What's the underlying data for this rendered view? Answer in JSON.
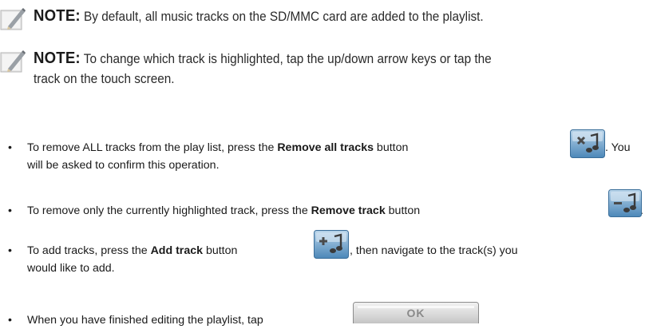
{
  "note1": {
    "label": "NOTE:",
    "text": " By default, all music tracks on the SD/MMC card are added to the playlist."
  },
  "note2": {
    "label": "NOTE:",
    "line1": " To change which track is highlighted, tap the up/down arrow keys or tap the",
    "line2": "track on the touch screen."
  },
  "bullets": {
    "b1": {
      "pre": "To remove ALL tracks from the play list, press the ",
      "bold": "Remove all tracks",
      "post": " button",
      "after": ". You",
      "line2": "will be asked to confirm this operation."
    },
    "b2": {
      "pre": "To remove only the currently highlighted track, press the ",
      "bold": "Remove track",
      "post": " button",
      "after": "."
    },
    "b3": {
      "pre": "To add tracks, press the ",
      "bold": "Add track",
      "post": " button",
      "after": ", then navigate to the track(s) you",
      "line2": "would like to add."
    },
    "b4": {
      "pre": "When you have finished editing the playlist, tap"
    }
  },
  "buttons": {
    "ok_label": "OK",
    "remove_all_icon": "remove-all-tracks-icon",
    "remove_track_icon": "remove-track-icon",
    "add_track_icon": "add-track-icon"
  },
  "bullet_char": "•"
}
